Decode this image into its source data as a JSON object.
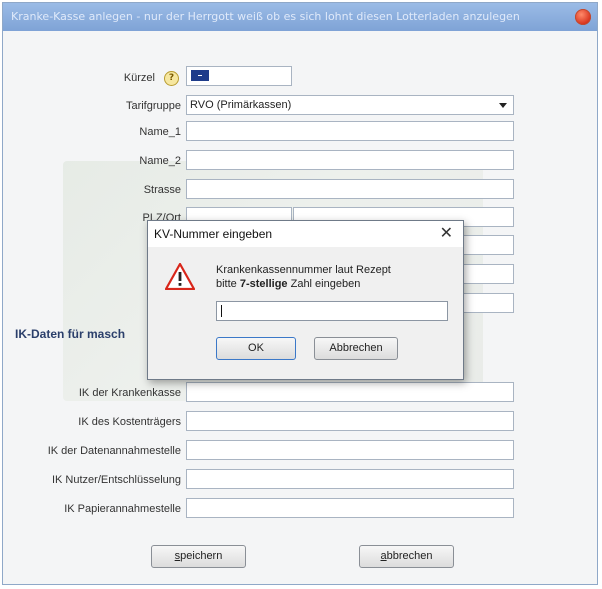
{
  "window": {
    "title": "Kranke-Kasse anlegen - nur der Herrgott weiß ob es sich lohnt diesen Lotterladen anzulegen"
  },
  "form": {
    "kuerzel_label": "Kürzel",
    "help_glyph": "?",
    "tarifgruppe_label": "Tarifgruppe",
    "tarifgruppe_value": "RVO (Primärkassen)",
    "name1_label": "Name_1",
    "name2_label": "Name_2",
    "strasse_label": "Strasse",
    "plzort_label": "PLZ/Ort",
    "telefon_label": "Te",
    "e_label": "E",
    "section_ik": "IK-Daten für masch",
    "ik_kk_label": "IK der Krankenkasse",
    "ik_kt_label": "IK des Kostenträgers",
    "ik_dat_label": "IK der Datenannahmestelle",
    "ik_nutzer_label": "IK Nutzer/Entschlüsselung",
    "ik_papier_label": "IK Papierannahmestelle",
    "save_prefix": "s",
    "save_rest": "peichern",
    "cancel_prefix": "a",
    "cancel_rest": "bbrechen"
  },
  "dialog": {
    "title": "KV-Nummer eingeben",
    "close_glyph": "✕",
    "line1": "Krankenkassennummer laut Rezept",
    "line2_prefix": "bitte ",
    "line2_bold": "7-stellige",
    "line2_suffix": " Zahl eingeben",
    "input_value": "",
    "ok_label": "OK",
    "cancel_label": "Abbrechen"
  }
}
